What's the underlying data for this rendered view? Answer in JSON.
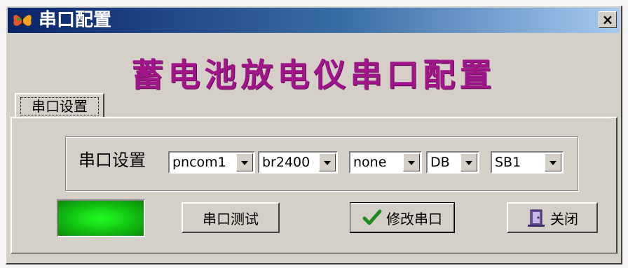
{
  "window": {
    "title": "串口配置",
    "close_label": "×",
    "icon": "app-butterfly-icon"
  },
  "heading": "蓄电池放电仪串口配置",
  "tabs": [
    {
      "label": "串口设置",
      "selected": true
    }
  ],
  "serial_settings": {
    "label": "串口设置",
    "port": "pncom1",
    "baud_rate": "br2400",
    "parity": "none",
    "data_bits": "DB",
    "stop_bits": "SB1"
  },
  "status_indicator": {
    "color": "#16c816",
    "state": "on"
  },
  "buttons": {
    "test": {
      "label": "串口测试"
    },
    "modify": {
      "label": "修改串口",
      "icon": "checkmark-icon"
    },
    "close": {
      "label": "关闭",
      "icon": "door-exit-icon"
    }
  },
  "colors": {
    "heading": "#a0158a",
    "titlebar_start": "#0a246a",
    "titlebar_end": "#a6caf0",
    "face": "#d4d0c8"
  }
}
